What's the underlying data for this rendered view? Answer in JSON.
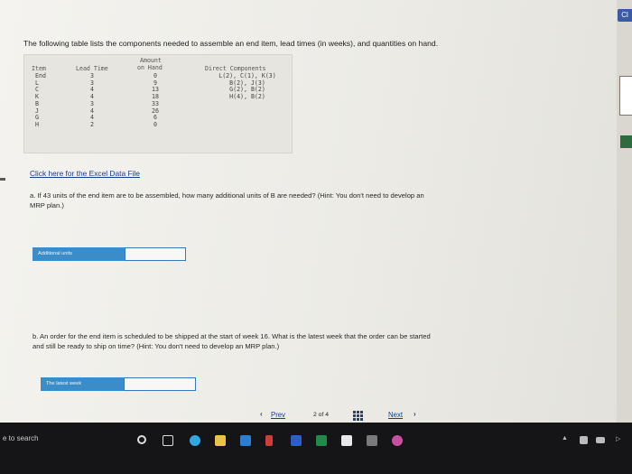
{
  "page": {
    "intro": "The following table lists the components needed to assemble an end item, lead times (in weeks), and quantities on hand.",
    "edge_chip": "Cl"
  },
  "table": {
    "headers": {
      "item": "Item",
      "lead_time": "Lead Time",
      "amount_line1": "Amount",
      "amount_line2": "on Hand",
      "components": "Direct Components"
    },
    "rows": [
      {
        "item": "End",
        "lead": "3",
        "amount": "0",
        "components": "L(2), C(1), K(3)"
      },
      {
        "item": "L",
        "lead": "3",
        "amount": "9",
        "components": "B(2), J(3)"
      },
      {
        "item": "C",
        "lead": "4",
        "amount": "13",
        "components": "G(2), B(2)"
      },
      {
        "item": "K",
        "lead": "4",
        "amount": "18",
        "components": "H(4), B(2)"
      },
      {
        "item": "B",
        "lead": "3",
        "amount": "33",
        "components": ""
      },
      {
        "item": "J",
        "lead": "4",
        "amount": "26",
        "components": ""
      },
      {
        "item": "G",
        "lead": "4",
        "amount": "6",
        "components": ""
      },
      {
        "item": "H",
        "lead": "2",
        "amount": "0",
        "components": ""
      }
    ]
  },
  "excel_link": "Click here for the Excel Data File",
  "question_a": {
    "line1": "a. If 43 units of the end item are to be assembled, how many additional units of B are needed? (Hint: You don't need to develop an",
    "line2": "MRP plan.)",
    "label": "Additional units",
    "value": ""
  },
  "question_b": {
    "line1": "b. An order for the end item is scheduled to be shipped at the start of week 16. What is the latest week that the order can be started",
    "line2": "and still be ready to ship on time? (Hint: You don't need to develop an MRP plan.)",
    "label": "The latest week",
    "value": ""
  },
  "pager": {
    "prev": "Prev",
    "status": "2 of 4",
    "next": "Next"
  },
  "taskbar": {
    "search": "e to search"
  },
  "colors": {
    "accent": "#3b8dc9",
    "link": "#1a3e8c"
  }
}
